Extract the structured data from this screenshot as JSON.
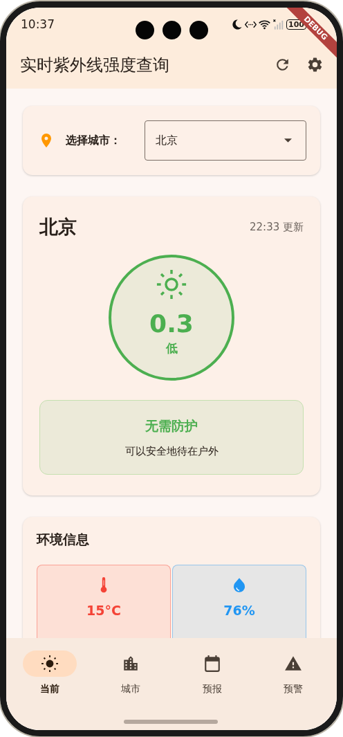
{
  "status_bar": {
    "time": "10:37",
    "battery": "100"
  },
  "debug_banner": "DEBUG",
  "app_bar": {
    "title": "实时紫外线强度查询"
  },
  "city_selector": {
    "label": "选择城市：",
    "value": "北京"
  },
  "uv_card": {
    "city": "北京",
    "updated": "22:33 更新",
    "uv_index": "0.3",
    "level_label": "低",
    "color": "#4caf50",
    "advice_title": "无需防护",
    "advice_text": "可以安全地待在户外"
  },
  "environment": {
    "title": "环境信息",
    "items": [
      {
        "kind": "temperature",
        "value": "15°C",
        "color": "#f44336"
      },
      {
        "kind": "humidity",
        "value": "76%",
        "color": "#2196f3"
      }
    ]
  },
  "bottom_nav": [
    {
      "kind": "sun",
      "label": "当前",
      "selected": true
    },
    {
      "kind": "city",
      "label": "城市",
      "selected": false
    },
    {
      "kind": "calendar",
      "label": "预报",
      "selected": false
    },
    {
      "kind": "warning",
      "label": "预警",
      "selected": false
    }
  ]
}
